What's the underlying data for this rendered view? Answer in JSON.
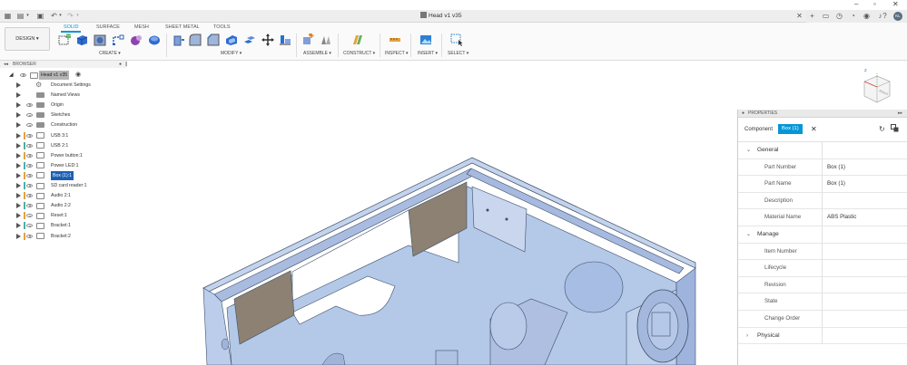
{
  "app": {
    "document_title": "Head v1 v35",
    "user_initials": "KL"
  },
  "toolbar": {
    "workspace": "DESIGN",
    "tabs": [
      "SOLID",
      "SURFACE",
      "MESH",
      "SHEET METAL",
      "TOOLS"
    ],
    "active_tab": "SOLID",
    "groups": [
      "CREATE",
      "MODIFY",
      "ASSEMBLE",
      "CONSTRUCT",
      "INSPECT",
      "INSERT",
      "SELECT"
    ]
  },
  "browser": {
    "title": "BROWSER",
    "root": "Head v1 v35",
    "items": [
      {
        "label": "Document Settings",
        "icon": "gear-icon"
      },
      {
        "label": "Named Views",
        "icon": "folder-icon"
      },
      {
        "label": "Origin",
        "icon": "folder-icon"
      },
      {
        "label": "Sketches",
        "icon": "folder-icon"
      },
      {
        "label": "Construction",
        "icon": "folder-icon"
      },
      {
        "label": "USB 3:1",
        "icon": "component-icon"
      },
      {
        "label": "USB 2:1",
        "icon": "component-icon"
      },
      {
        "label": "Power button:1",
        "icon": "component-icon"
      },
      {
        "label": "Power LED:1",
        "icon": "component-icon"
      },
      {
        "label": "Box (1):1",
        "icon": "component-icon",
        "selected": true
      },
      {
        "label": "SD card reader:1",
        "icon": "component-icon"
      },
      {
        "label": "Audio 2:1",
        "icon": "component-icon"
      },
      {
        "label": "Audio 2:2",
        "icon": "component-icon"
      },
      {
        "label": "Reset:1",
        "icon": "component-icon"
      },
      {
        "label": "Bracket:1",
        "icon": "component-icon"
      },
      {
        "label": "Bracket:2",
        "icon": "component-icon"
      }
    ]
  },
  "properties": {
    "title": "PROPERTIES",
    "filter_label": "Component",
    "filter_value": "Box (1)",
    "sections": [
      {
        "name": "General",
        "expanded": true,
        "rows": [
          {
            "key": "Part Number",
            "value": "Box (1)"
          },
          {
            "key": "Part Name",
            "value": "Box (1)"
          },
          {
            "key": "Description",
            "value": ""
          },
          {
            "key": "Material Name",
            "value": "ABS Plastic"
          }
        ]
      },
      {
        "name": "Manage",
        "expanded": true,
        "rows": [
          {
            "key": "Item Number",
            "value": ""
          },
          {
            "key": "Lifecycle",
            "value": ""
          },
          {
            "key": "Revision",
            "value": ""
          },
          {
            "key": "State",
            "value": ""
          },
          {
            "key": "Change Order",
            "value": ""
          }
        ]
      },
      {
        "name": "Physical",
        "expanded": false,
        "rows": []
      }
    ]
  },
  "colors": {
    "accent": "#0696d7",
    "model_fill": "#b4c8e8",
    "model_edge": "#3c4e6a",
    "insert_fill": "#8c8172"
  }
}
